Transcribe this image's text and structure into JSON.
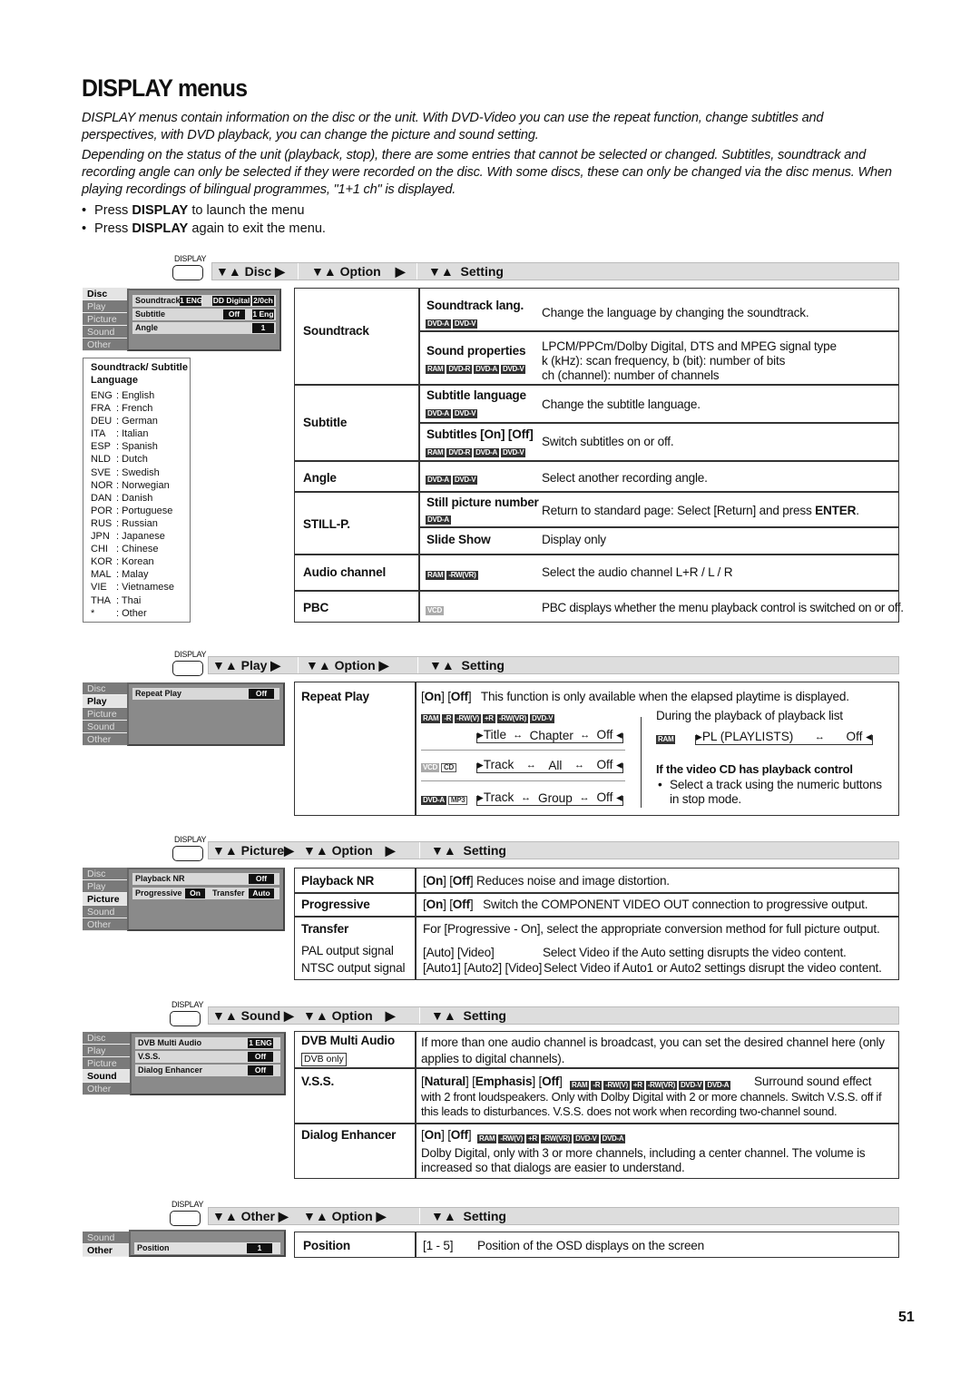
{
  "title": "DISPLAY menus",
  "intro": [
    "DISPLAY menus contain information on the disc or the unit. With DVD-Video you can use the repeat function, change subtitles and perspectives, with DVD playback, you can change the picture and sound setting.",
    "Depending on the status of the unit (playback, stop), there are some entries that cannot be selected or changed. Subtitles, soundtrack and recording angle can only be selected if they were recorded on the disc. With some discs, these can only be changed via the disc menus. When playing recordings of bilingual programmes, \"1+1 ch\" is displayed."
  ],
  "bullets": [
    {
      "pre": "Press ",
      "bold": "DISPLAY",
      "post": " to launch the menu"
    },
    {
      "pre": "Press ",
      "bold": "DISPLAY",
      "post": " again to exit the menu."
    }
  ],
  "display_label": "DISPLAY",
  "option_label": "Option",
  "setting_label": "Setting",
  "osd_tabs": [
    "Disc",
    "Play",
    "Picture",
    "Sound",
    "Other"
  ],
  "sections": {
    "disc": {
      "menu_label": "Disc",
      "osd": {
        "soundtrack": {
          "label": "Soundtrack",
          "v1": "1 ENG",
          "v2": "DD Digital",
          "v3": "2/0ch"
        },
        "subtitle": {
          "label": "Subtitle",
          "v1": "Off",
          "v2": "1 Eng"
        },
        "angle": {
          "label": "Angle",
          "v1": "1"
        }
      },
      "language_box": {
        "title": "Soundtrack/ Subtitle Language",
        "languages": [
          {
            "code": "ENG",
            "name": "English"
          },
          {
            "code": "FRA",
            "name": "French"
          },
          {
            "code": "DEU",
            "name": "German"
          },
          {
            "code": "ITA",
            "name": "Italian"
          },
          {
            "code": "ESP",
            "name": "Spanish"
          },
          {
            "code": "NLD",
            "name": "Dutch"
          },
          {
            "code": "SVE",
            "name": "Swedish"
          },
          {
            "code": "NOR",
            "name": "Norwegian"
          },
          {
            "code": "DAN",
            "name": "Danish"
          },
          {
            "code": "POR",
            "name": "Portuguese"
          },
          {
            "code": "RUS",
            "name": "Russian"
          },
          {
            "code": "JPN",
            "name": "Japanese"
          },
          {
            "code": "CHI",
            "name": "Chinese"
          },
          {
            "code": "KOR",
            "name": "Korean"
          },
          {
            "code": "MAL",
            "name": "Malay"
          },
          {
            "code": "VIE",
            "name": "Vietnamese"
          },
          {
            "code": "THA",
            "name": "Thai"
          },
          {
            "code": "*",
            "name": "Other"
          }
        ]
      },
      "options": {
        "soundtrack": "Soundtrack",
        "subtitle": "Subtitle",
        "angle": "Angle",
        "stillp": "STILL-P.",
        "audio": "Audio channel",
        "pbc": "PBC"
      },
      "settings": {
        "st_lang": {
          "name": "Soundtrack lang.",
          "badges": [
            "DVD-A",
            "DVD-V"
          ],
          "desc": "Change the language by changing the soundtrack."
        },
        "sound_props": {
          "name": "Sound properties",
          "badges": [
            "RAM",
            "DVD-R",
            "DVD-A",
            "DVD-V"
          ],
          "desc1": "LPCM/PPCm/Dolby Digital, DTS and MPEG signal type",
          "desc2": "k (kHz): scan frequency, b (bit): number of bits",
          "desc3": "ch (channel): number of channels"
        },
        "sub_lang": {
          "name": "Subtitle language",
          "badges": [
            "DVD-A",
            "DVD-V"
          ],
          "desc": "Change the subtitle language."
        },
        "sub_onoff": {
          "name": "Subtitles [On] [Off]",
          "badges": [
            "RAM",
            "DVD-R",
            "DVD-A",
            "DVD-V"
          ],
          "desc": "Switch subtitles on or off."
        },
        "angle": {
          "badges": [
            "DVD-A",
            "DVD-V"
          ],
          "desc": "Select another recording angle."
        },
        "still": {
          "name": "Still picture number",
          "badges": [
            "DVD-A"
          ],
          "desc_pre": "Return to standard page: Select [Return] and press ",
          "desc_bold": "ENTER",
          "desc_post": "."
        },
        "slide": {
          "name": "Slide Show",
          "desc": "Display only"
        },
        "audio": {
          "badges": [
            "RAM",
            "-RW(VR)"
          ],
          "desc": "Select the audio channel L+R / L / R"
        },
        "pbc": {
          "badges": [
            "VCD"
          ],
          "desc": "PBC displays whether the menu playback control is switched on or off."
        }
      }
    },
    "play": {
      "menu_label": "Play",
      "osd": {
        "repeat": {
          "label": "Repeat Play",
          "v1": "Off"
        }
      },
      "option": "Repeat Play",
      "intro_on": "On",
      "intro_off": "Off",
      "intro_desc": "This function is only available when the elapsed playtime is displayed.",
      "badges1": [
        "RAM",
        "-R",
        "-RW(V)",
        "+R",
        "-RW(VR)",
        "DVD-V"
      ],
      "cycle1": [
        "Title",
        "Chapter",
        "Off"
      ],
      "badges2": [
        "VCD",
        "CD"
      ],
      "cycle2": [
        "Track",
        "All",
        "Off"
      ],
      "badges3": [
        "DVD-A",
        "MP3"
      ],
      "cycle3": [
        "Track",
        "Group",
        "Off"
      ],
      "pl_desc": "During the playback of playback list",
      "pl_badge": "RAM",
      "pl_cycle": [
        "PL (PLAYLISTS)",
        "Off"
      ],
      "vcd_title": "If the video CD has playback control",
      "vcd_bullet": "Select a track using the numeric buttons in stop mode."
    },
    "picture": {
      "menu_label": "Picture",
      "osd": {
        "nr": {
          "label": "Playback NR",
          "v1": "Off"
        },
        "prog": {
          "label": "Progressive",
          "v1": "On",
          "label2": "Transfer",
          "v2": "Auto"
        }
      },
      "rows": {
        "nr": {
          "option": "Playback NR",
          "on": "On",
          "off": "Off",
          "desc": "Reduces noise and image distortion."
        },
        "prog": {
          "option": "Progressive",
          "on": "On",
          "off": "Off",
          "desc": "Switch the COMPONENT VIDEO OUT connection to progressive output."
        },
        "transfer": {
          "option": "Transfer",
          "desc": "For [Progressive - On], select the appropriate conversion method for full picture output.",
          "pal_label": "PAL output signal",
          "ntsc_label": "NTSC output signal",
          "pal_vals": "[Auto] [Video]",
          "pal_desc": "Select Video if the Auto setting disrupts the video content.",
          "ntsc_vals": "[Auto1] [Auto2] [Video]",
          "ntsc_desc": "Select Video if Auto1 or Auto2 settings disrupt the video content."
        }
      }
    },
    "sound": {
      "menu_label": "Sound",
      "osd": {
        "dvb": {
          "label": "DVB Multi Audio",
          "v1": "1 ENG"
        },
        "vss": {
          "label": "V.S.S.",
          "v1": "Off"
        },
        "dialog": {
          "label": "Dialog Enhancer",
          "v1": "Off"
        }
      },
      "rows": {
        "dvb": {
          "option": "DVB Multi Audio",
          "tag": "DVB only",
          "desc": "If more than one audio channel is broadcast, you can set the desired channel here (only applies to digital channels)."
        },
        "vss": {
          "option": "V.S.S.",
          "o1": "Natural",
          "o2": "Emphasis",
          "o3": "Off",
          "badges": [
            "RAM",
            "-R",
            "-RW(V)",
            "+R",
            "-RW(VR)",
            "DVD-V",
            "DVD-A"
          ],
          "desc_inline": "Surround sound effect",
          "desc": "with 2 front loudspeakers. Only with Dolby Digital with 2 or more channels. Switch V.S.S. off if this leads to disturbances. V.S.S. does not work when recording two-channel sound."
        },
        "dialog": {
          "option": "Dialog Enhancer",
          "on": "On",
          "off": "Off",
          "badges": [
            "RAM",
            "-RW(V)",
            "+R",
            "-RW(VR)",
            "DVD-V",
            "DVD-A"
          ],
          "desc": "Dolby Digital, only with 3 or more channels, including a center channel. The volume is increased so that dialogs are easier to understand."
        }
      }
    },
    "other": {
      "menu_label": "Other",
      "osd_tabs": [
        "Sound",
        "Other"
      ],
      "osd": {
        "position": {
          "label": "Position",
          "v1": "1"
        }
      },
      "option": "Position",
      "range": "[1 - 5]",
      "desc": "Position of the OSD displays on the screen"
    }
  },
  "page_number": "51"
}
